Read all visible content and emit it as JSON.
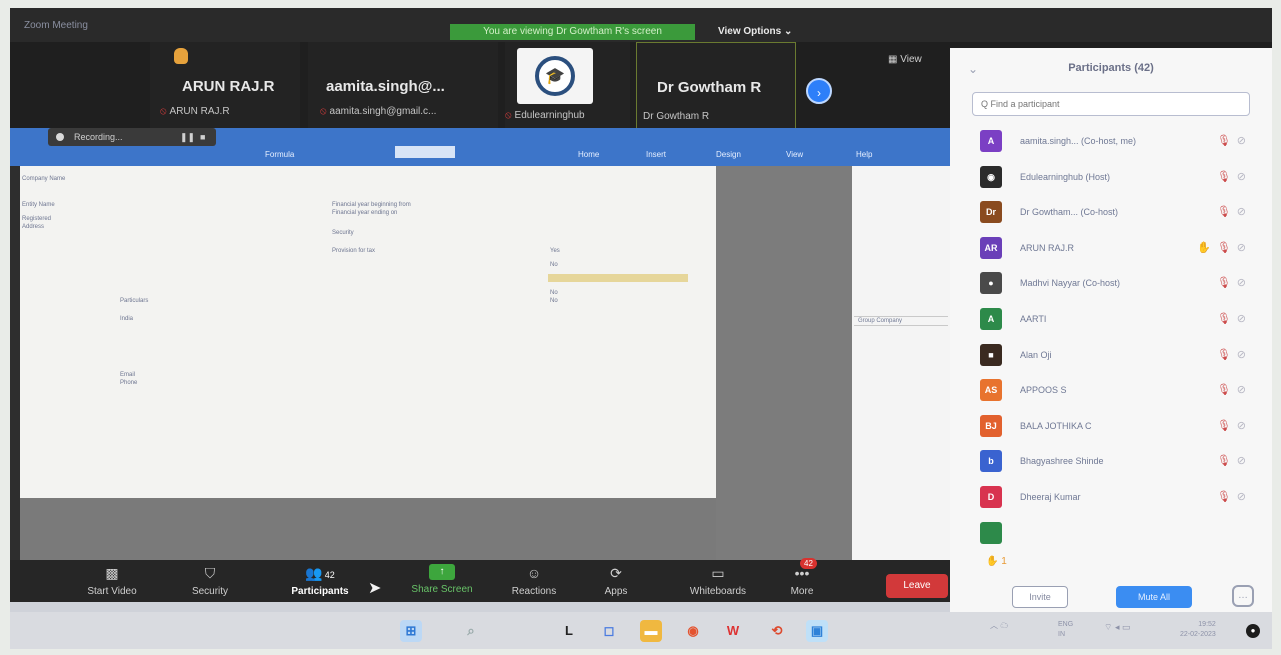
{
  "window": {
    "title": "Zoom Meeting"
  },
  "banner": "You are viewing Dr Gowtham R's screen",
  "view_options": "View Options ⌄",
  "view_button": "▦ View",
  "tiles": [
    {
      "name": "ARUN RAJ.R",
      "sub": "ARUN RAJ.R"
    },
    {
      "name": "aamita.singh@...",
      "sub": "aamita.singh@gmail.c..."
    },
    {
      "name": "",
      "sub": "Edulearninghub"
    },
    {
      "name": "Dr Gowtham R",
      "sub": "Dr Gowtham R"
    }
  ],
  "recording": {
    "label": "Recording..."
  },
  "ribbon_tabs": [
    "Formula",
    "Home",
    "Insert",
    "Design",
    "View",
    "Help"
  ],
  "document": {
    "lines_left": [
      "Company Name",
      "Entity Name",
      "Registered",
      "Address",
      "Particulars",
      "India",
      "Email",
      "Phone"
    ],
    "lines_right": [
      "Financial year beginning from",
      "Financial year ending on",
      "Security",
      "Provision for tax",
      "Yes",
      "No",
      "No",
      "No"
    ]
  },
  "side_pane_highlight": "Group Company",
  "toolbar": {
    "stop_video": "Start Video",
    "security": "Security",
    "participants": "Participants",
    "participants_count": "42",
    "share_screen": "Share Screen",
    "reactions": "Reactions",
    "apps": "Apps",
    "whiteboards": "Whiteboards",
    "more": "More",
    "more_badge": "42",
    "leave": "Leave"
  },
  "panel": {
    "title": "Participants (42)",
    "search_placeholder": "Q Find a participant",
    "participants": [
      {
        "initials": "A",
        "name": "aamita.singh... (Co-host, me)",
        "color": "#7b3fc4",
        "hand": false,
        "mic": true,
        "video": true
      },
      {
        "initials": "◉",
        "name": "Edulearninghub (Host)",
        "color": "#2b2b2b",
        "hand": false,
        "mic": true,
        "video": true
      },
      {
        "initials": "Dr",
        "name": "Dr Gowtham... (Co-host)",
        "color": "#8a4b1f",
        "hand": false,
        "mic": true,
        "video": true
      },
      {
        "initials": "AR",
        "name": "ARUN RAJ.R",
        "color": "#6a3fb8",
        "hand": true,
        "mic": true,
        "video": true
      },
      {
        "initials": "●",
        "name": "Madhvi Nayyar (Co-host)",
        "color": "#4a4a4a",
        "hand": false,
        "mic": true,
        "video": true
      },
      {
        "initials": "A",
        "name": "AARTI",
        "color": "#2d8a4a",
        "hand": false,
        "mic": true,
        "video": true
      },
      {
        "initials": "■",
        "name": "Alan Oji",
        "color": "#3a2a20",
        "hand": false,
        "mic": true,
        "video": true
      },
      {
        "initials": "AS",
        "name": "APPOOS S",
        "color": "#e8732e",
        "hand": false,
        "mic": true,
        "video": true
      },
      {
        "initials": "BJ",
        "name": "BALA JOTHIKA C",
        "color": "#e2612e",
        "hand": false,
        "mic": true,
        "video": true
      },
      {
        "initials": "b",
        "name": "Bhagyashree Shinde",
        "color": "#3a63d0",
        "hand": false,
        "mic": true,
        "video": true
      },
      {
        "initials": "D",
        "name": "Dheeraj Kumar",
        "color": "#d8334f",
        "hand": false,
        "mic": true,
        "video": true
      },
      {
        "initials": "",
        "name": "",
        "color": "#2d8a4a",
        "hand": false,
        "mic": false,
        "video": false
      }
    ],
    "invite": "Invite",
    "mute_all": "Mute All"
  },
  "taskbar": {
    "lang": "ENG\nIN",
    "clock_time": "19:52",
    "clock_date": "22-02-2023"
  },
  "colors": {
    "accent_blue": "#2d7ff9",
    "leave_red": "#d2393a",
    "share_green": "#3da63d",
    "ribbon_blue": "#3d75c9"
  }
}
